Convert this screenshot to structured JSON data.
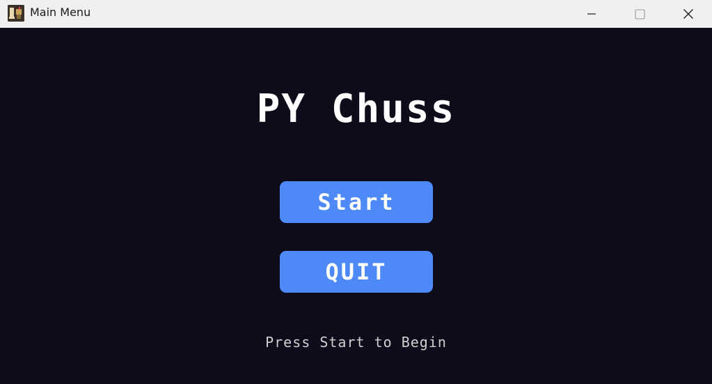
{
  "window": {
    "title": "Main Menu",
    "icon": "chess-app-icon",
    "controls": {
      "minimize": "minimize-icon",
      "maximize": "maximize-icon",
      "close": "close-icon"
    }
  },
  "game": {
    "title": "PY Chuss",
    "start_label": "Start",
    "quit_label": "QUIT",
    "hint": "Press Start to Begin"
  },
  "colors": {
    "background": "#0c0c1a",
    "button": "#4d8af8",
    "text": "#ffffff",
    "hint_text": "#d0d0d0",
    "titlebar": "#f0f0f0"
  }
}
